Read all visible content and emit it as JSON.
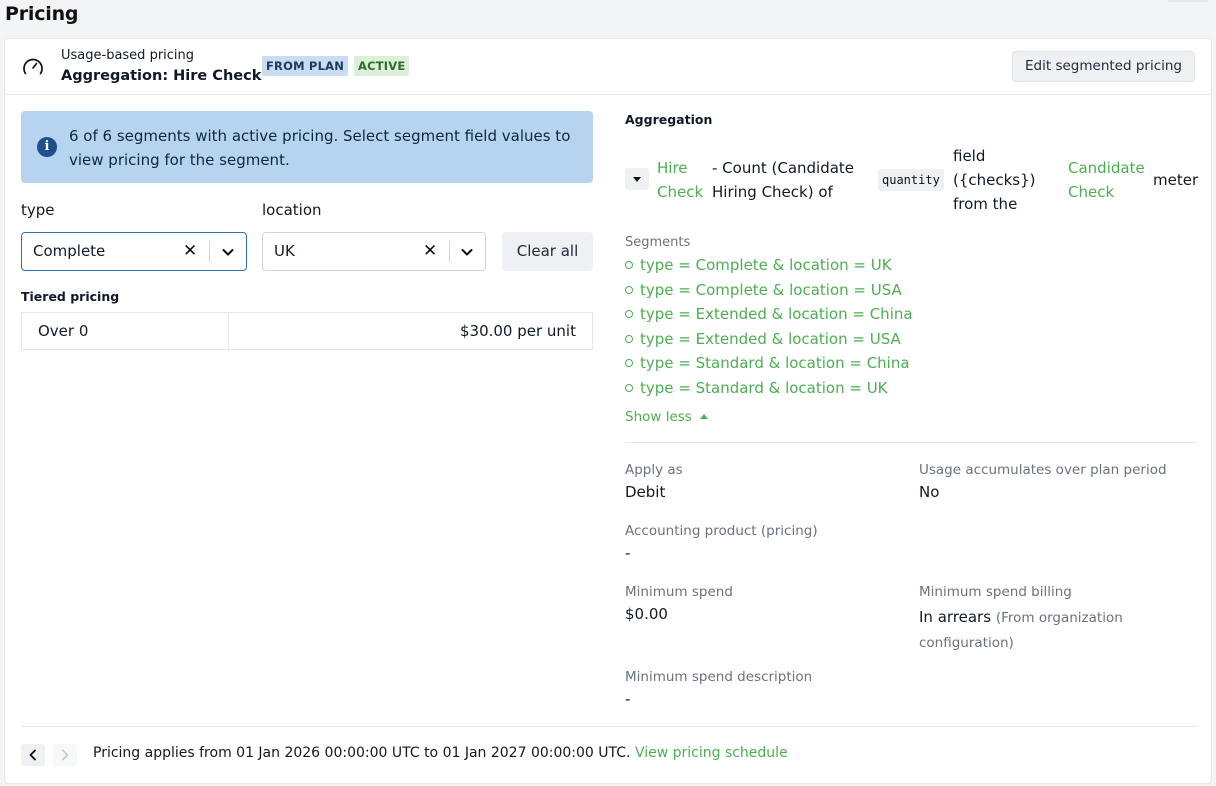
{
  "page": {
    "title": "Pricing"
  },
  "header": {
    "subtitle": "Usage-based pricing",
    "title": "Aggregation: Hire Check",
    "badges": {
      "plan": "FROM PLAN",
      "active": "ACTIVE"
    },
    "edit_button": "Edit segmented pricing",
    "icon": "gauge-icon"
  },
  "info": {
    "icon": "info-icon",
    "text": "6 of 6 segments with active pricing. Select segment field values to view pricing for the segment."
  },
  "filters": {
    "type": {
      "label": "type",
      "value": "Complete"
    },
    "location": {
      "label": "location",
      "value": "UK"
    },
    "clear_glyph": "✕",
    "clear_all": "Clear all"
  },
  "tiered": {
    "label": "Tiered pricing",
    "rows": [
      {
        "range": "Over 0",
        "price": "$30.00 per unit"
      }
    ]
  },
  "aggregation": {
    "title": "Aggregation",
    "name_line1": "Hire",
    "name_line2": "Check",
    "desc_line1": "- Count (Candidate",
    "desc_line2": "Hiring Check) of",
    "field_code": "quantity",
    "field_line1": "field",
    "field_line2": "({checks})",
    "field_line3": "from the",
    "meter_line1": "Candidate",
    "meter_line2": "Check",
    "meter_word": "meter"
  },
  "segments": {
    "label": "Segments",
    "items": [
      "type = Complete & location = UK",
      "type = Complete & location = USA",
      "type = Extended & location = China",
      "type = Extended & location = USA",
      "type = Standard & location = China",
      "type = Standard & location = UK"
    ],
    "show_less": "Show less"
  },
  "properties": {
    "apply_as": {
      "label": "Apply as",
      "value": "Debit"
    },
    "usage_accumulates": {
      "label": "Usage accumulates over plan period",
      "value": "No"
    },
    "accounting_product": {
      "label": "Accounting product (pricing)",
      "value": "-"
    },
    "minimum_spend": {
      "label": "Minimum spend",
      "value": "$0.00"
    },
    "minimum_spend_billing": {
      "label": "Minimum spend billing",
      "value": "In arrears",
      "note_line1": "(From organization",
      "note_line2": "configuration)"
    },
    "minimum_spend_description": {
      "label": "Minimum spend description",
      "value": "-"
    }
  },
  "footer": {
    "text": "Pricing applies from 01 Jan 2026 00:00:00 UTC to 01 Jan 2027 00:00:00 UTC.",
    "link": "View pricing schedule"
  },
  "colors": {
    "accent_green": "#4caf50",
    "info_bg": "#b6d4f0",
    "badge_plan_bg": "#c9dcf0",
    "badge_active_bg": "#dcefd7"
  }
}
